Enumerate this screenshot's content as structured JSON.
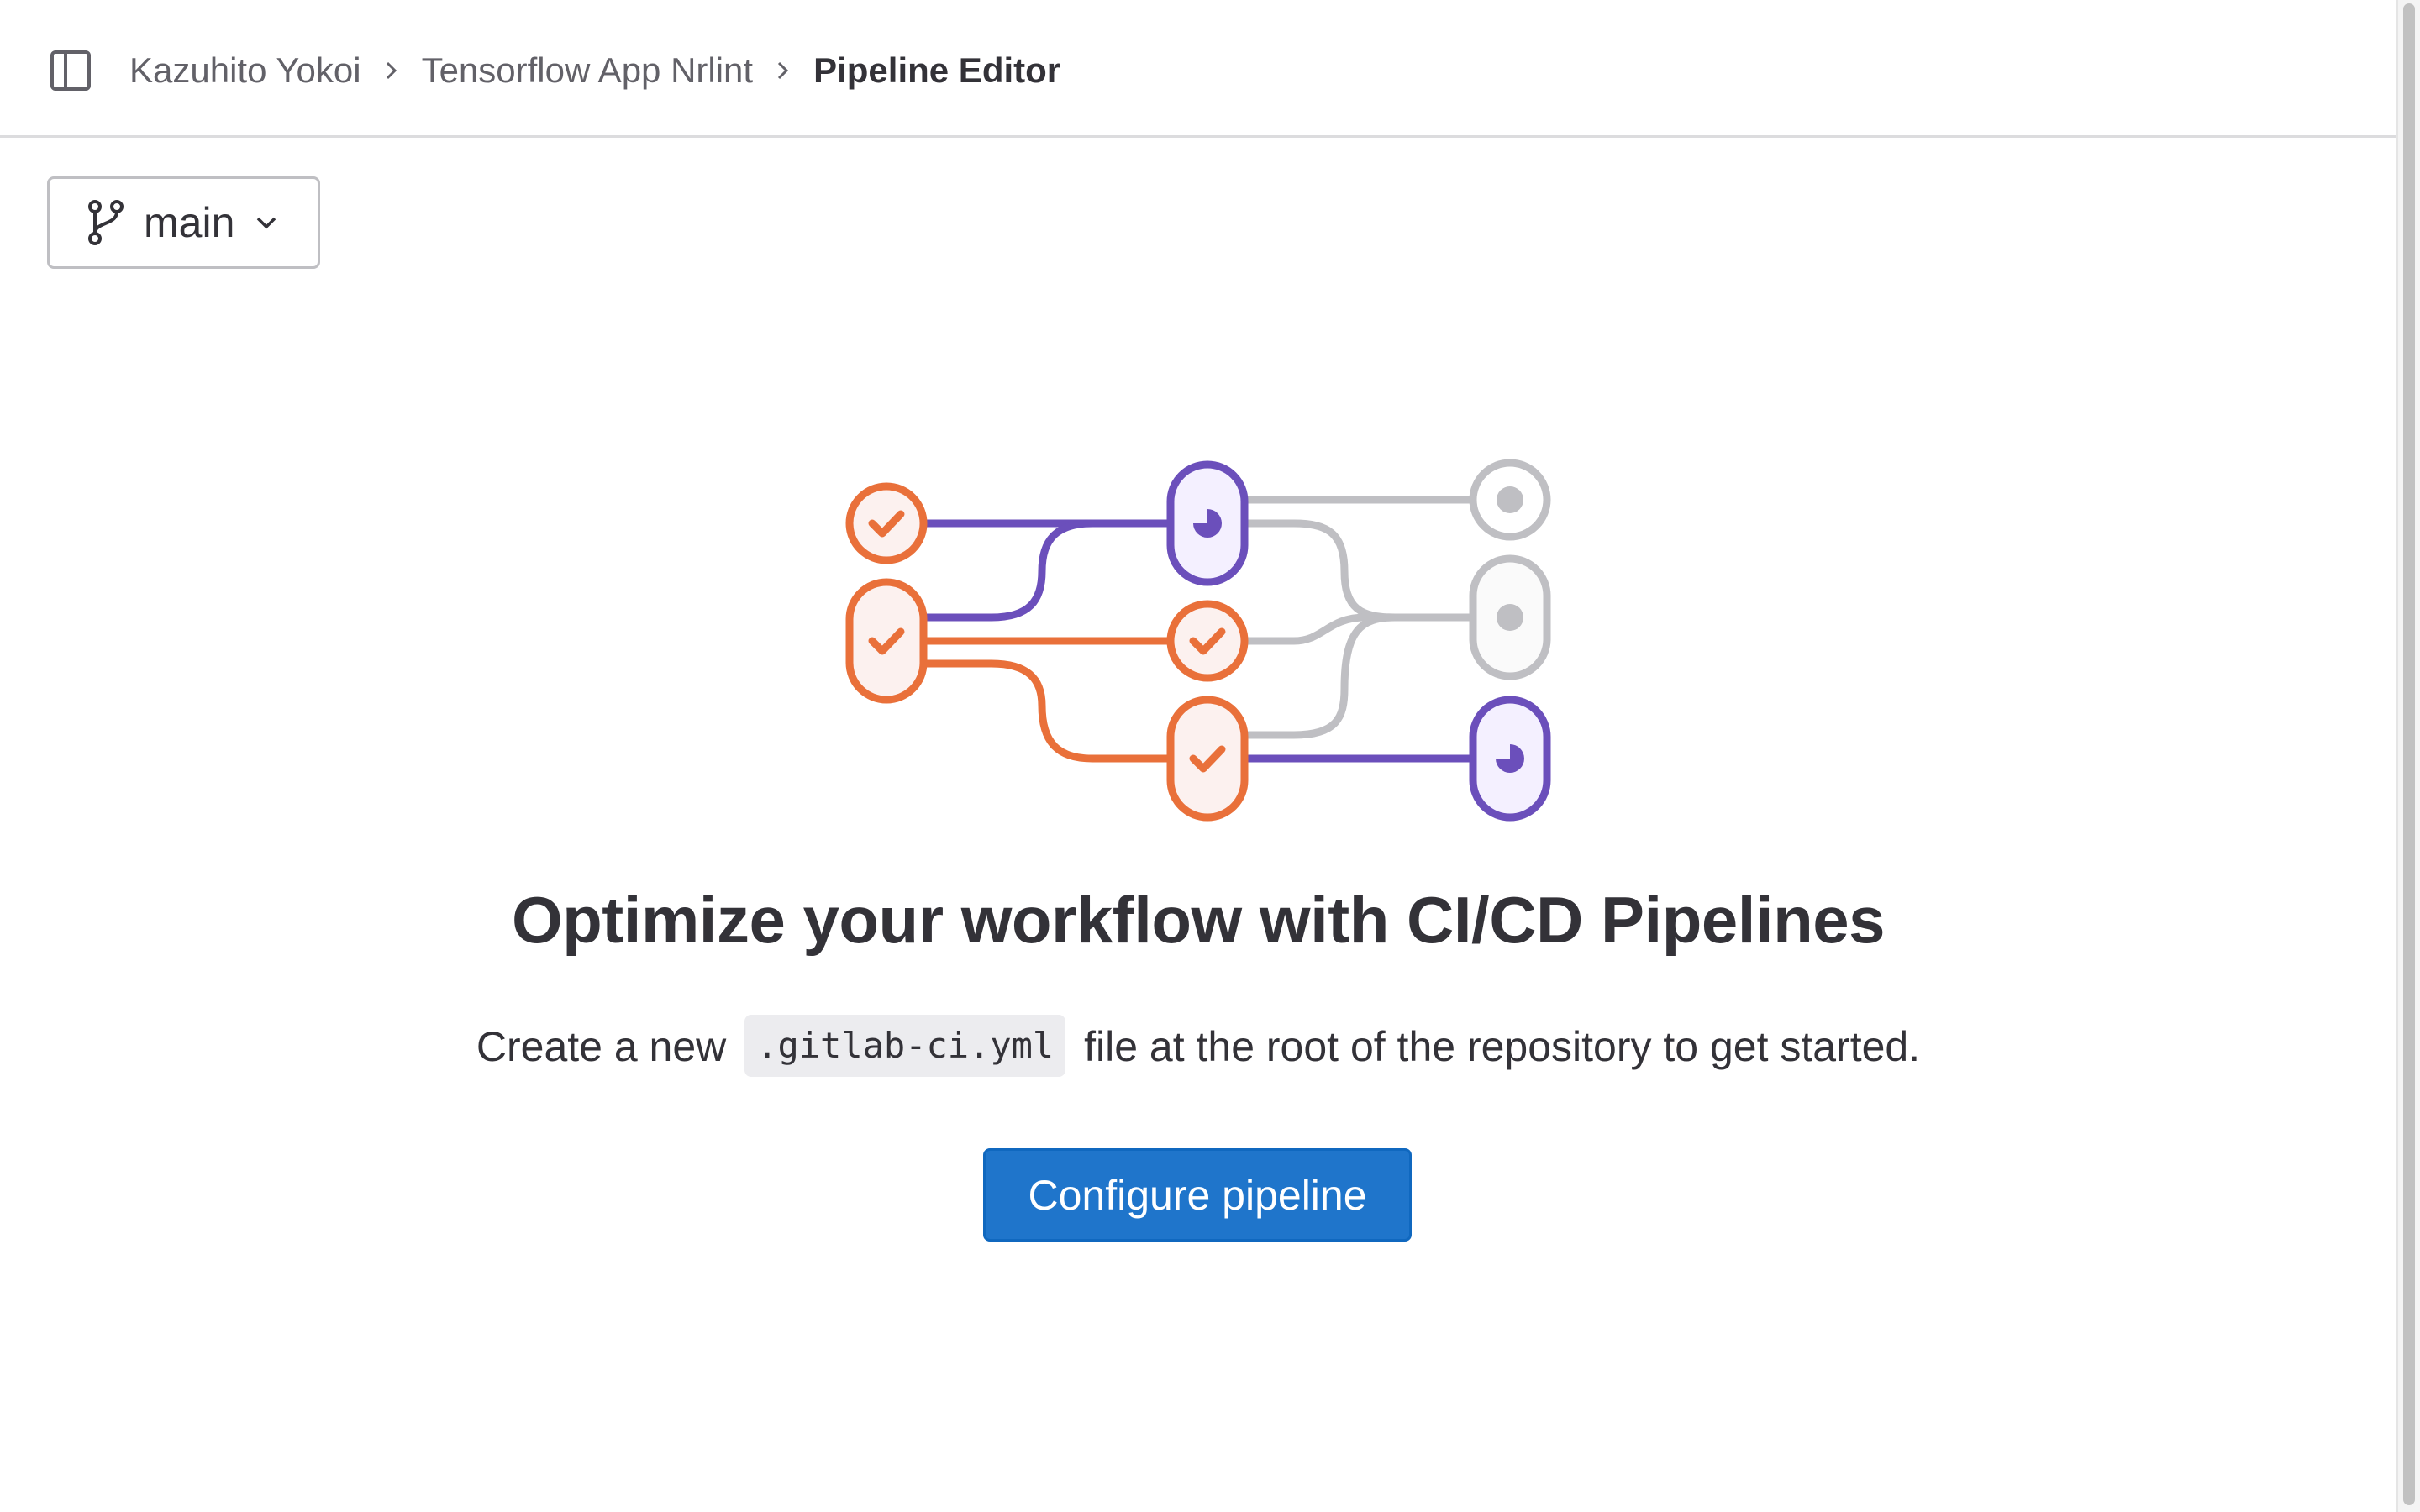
{
  "breadcrumb": {
    "items": [
      "Kazuhito Yokoi",
      "Tensorflow App Nrlint"
    ],
    "current": "Pipeline Editor"
  },
  "branch_selector": {
    "label": "main",
    "icon": "branch-icon"
  },
  "empty_state": {
    "title": "Optimize your workflow with CI/CD Pipelines",
    "description_before": "Create a new",
    "file_name": ".gitlab-ci.yml",
    "description_after": "file at the root of the repository to get started.",
    "button_label": "Configure pipeline"
  },
  "colors": {
    "accent": "#1f75cb",
    "success_orange": "#e9703a",
    "running_purple": "#6b4fbb",
    "inactive_gray": "#bfbfc3"
  }
}
